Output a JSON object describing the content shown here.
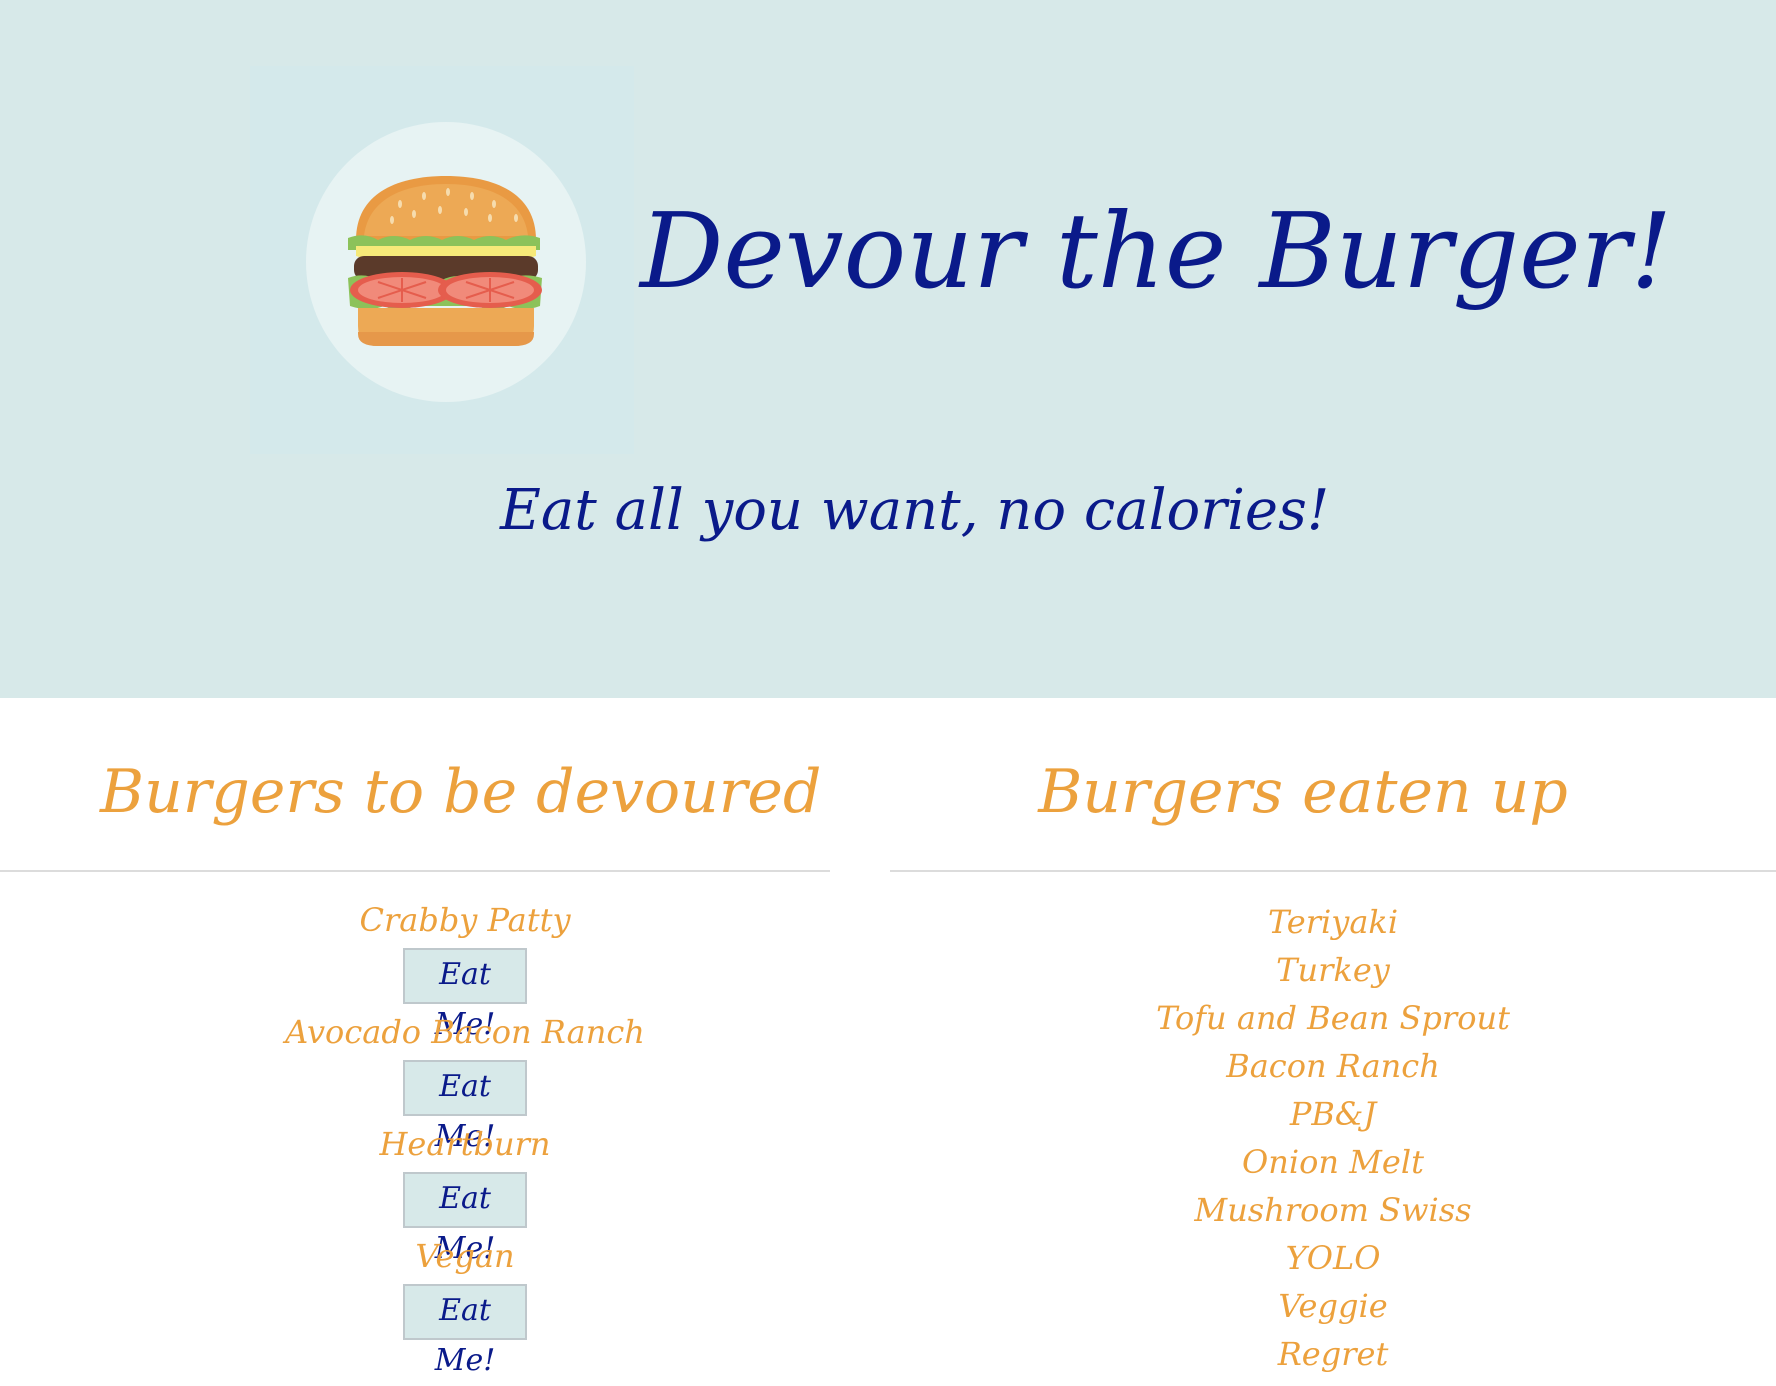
{
  "header": {
    "title": "Devour the Burger!",
    "tagline": "Eat all you want, no calories!",
    "logo_icon": "burger-icon"
  },
  "colors": {
    "header_bg": "#d7e9e9",
    "navy": "#0a1a8a",
    "orange": "#eca13d"
  },
  "to_devour": {
    "heading": "Burgers to be devoured",
    "button_label": "Eat Me!",
    "items": [
      {
        "name": "Crabby Patty",
        "button": "Eat Me!"
      },
      {
        "name": "Avocado Bacon Ranch",
        "button": "Eat Me!"
      },
      {
        "name": "Heartburn",
        "button": "Eat Me!"
      },
      {
        "name": "Vegan",
        "button": "Eat Me!"
      }
    ]
  },
  "eaten": {
    "heading": "Burgers eaten up",
    "items": [
      "Teriyaki",
      "Turkey",
      "Tofu and Bean Sprout",
      "Bacon Ranch",
      "PB&J",
      "Onion Melt",
      "Mushroom Swiss",
      "YOLO",
      "Veggie",
      "Regret"
    ]
  }
}
